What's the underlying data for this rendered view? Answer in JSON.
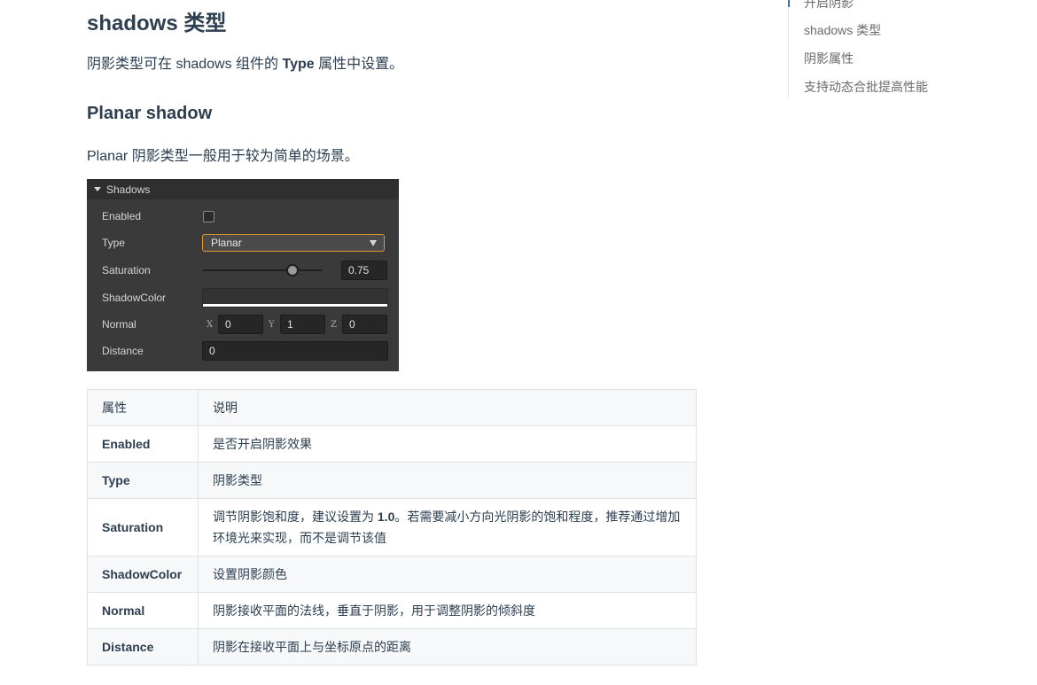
{
  "heading": "shadows 类型",
  "intro": {
    "pre": "阴影类型可在 shadows 组件的 ",
    "bold": "Type",
    "post": " 属性中设置。"
  },
  "subheading": "Planar shadow",
  "planar_desc": "Planar 阴影类型一般用于较为简单的场景。",
  "panel": {
    "title": "Shadows",
    "enabled_label": "Enabled",
    "enabled_checked": false,
    "type_label": "Type",
    "type_value": "Planar",
    "saturation_label": "Saturation",
    "saturation_value": "0.75",
    "saturation_fraction": 0.75,
    "shadowcolor_label": "ShadowColor",
    "normal_label": "Normal",
    "normal": {
      "x_label": "X",
      "x": "0",
      "y_label": "Y",
      "y": "1",
      "z_label": "Z",
      "z": "0"
    },
    "distance_label": "Distance",
    "distance_value": "0"
  },
  "table": {
    "headers": [
      "属性",
      "说明"
    ],
    "rows": [
      {
        "key": "Enabled",
        "desc": "是否开启阴影效果"
      },
      {
        "key": "Type",
        "desc": "阴影类型"
      },
      {
        "key": "Saturation",
        "desc_pre": "调节阴影饱和度，建议设置为 ",
        "desc_bold": "1.0",
        "desc_post": "。若需要减小方向光阴影的饱和程度，推荐通过增加环境光来实现，而不是调节该值"
      },
      {
        "key": "ShadowColor",
        "desc": "设置阴影颜色"
      },
      {
        "key": "Normal",
        "desc": "阴影接收平面的法线，垂直于阴影，用于调整阴影的倾斜度"
      },
      {
        "key": "Distance",
        "desc": "阴影在接收平面上与坐标原点的距离"
      }
    ]
  },
  "toc": {
    "items": [
      "开启阴影",
      "shadows 类型",
      "阴影属性",
      "支持动态合批提高性能"
    ]
  }
}
